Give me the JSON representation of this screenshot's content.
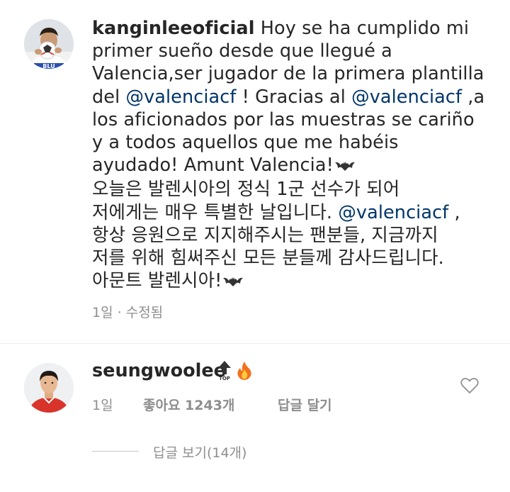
{
  "caption": {
    "username": "kanginleeoficial",
    "lines": [
      {
        "t1": " Hoy se ha cumplido mi"
      },
      {
        "t1": "primer sueño desde que llegué a"
      },
      {
        "t1": "Valencia,ser jugador de la primera plantilla"
      },
      {
        "t1": "del ",
        "m1": "@valenciacf",
        "t2": " ! Gracias al ",
        "m2": "@valenciacf",
        "t3": " ,a"
      },
      {
        "t1": "los aficionados por las muestras se cariño"
      },
      {
        "t1": "y a todos aquellos que me habéis"
      },
      {
        "t1": "ayudado! Amunt Valencia!"
      },
      {
        "t1": "오늘은 발렌시아의 정식 1군 선수가 되어"
      },
      {
        "t1": "저에게는 매우 특별한 날입니다. ",
        "m1": "@valenciacf",
        "t2": " ,"
      },
      {
        "t1": "항상 응원으로 지지해주시는 팬분들, 지금까지"
      },
      {
        "t1": "저를 위해 힘써주신 모든 분들께 감사드립니다."
      },
      {
        "t1": "아문트 발렌시아!"
      }
    ],
    "time": "1일",
    "separator": "·",
    "edited": "수정됨",
    "avatar_jersey_text": "BLU"
  },
  "comment": {
    "username": "seungwoolee",
    "emoji_1": "top-arrow-icon",
    "emoji_1_text": "TOP",
    "emoji_2": "fire-icon",
    "time": "1일",
    "likes": "좋아요 1243개",
    "reply": "답글 달기",
    "view_replies": "답글 보기(14개)"
  },
  "colors": {
    "text": "#262626",
    "mention": "#003569",
    "meta": "#8e8e8e",
    "divider": "#efefef"
  }
}
